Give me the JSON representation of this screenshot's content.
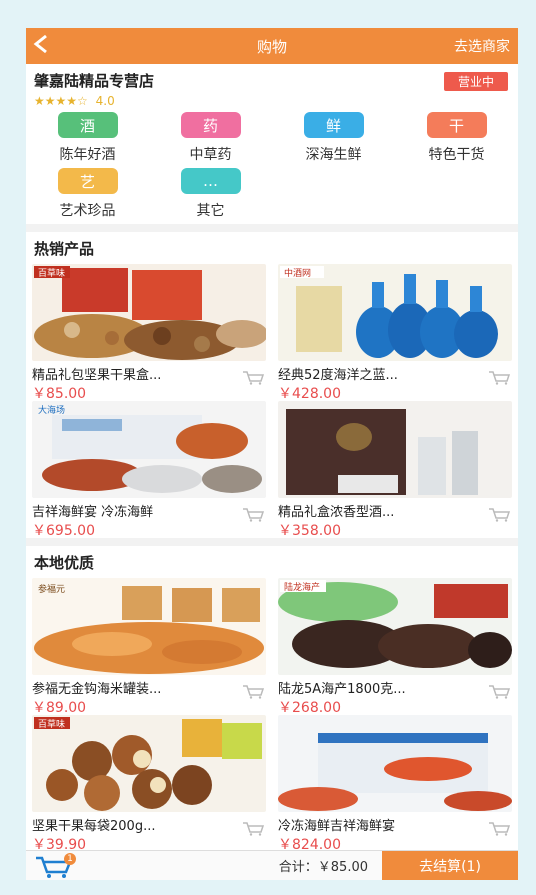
{
  "topbar": {
    "back_icon": "back-arrow-icon",
    "title": "购物",
    "right_label": "去选商家"
  },
  "store": {
    "name": "肇嘉陆精品专营店",
    "stars": "★★★★☆",
    "score": "4.0",
    "status": "营业中"
  },
  "categories": [
    {
      "icon_text": "酒",
      "label": "陈年好酒",
      "color": "#57c07a"
    },
    {
      "icon_text": "药",
      "label": "中草药",
      "color": "#f06fa0"
    },
    {
      "icon_text": "鲜",
      "label": "深海生鲜",
      "color": "#3aaee6"
    },
    {
      "icon_text": "干",
      "label": "特色干货",
      "color": "#f47c5a"
    },
    {
      "icon_text": "艺",
      "label": "艺术珍品",
      "color": "#f3b94a"
    },
    {
      "icon_text": "…",
      "label": "其它",
      "color": "#45c8c8"
    }
  ],
  "hot": {
    "title": "热销产品",
    "items": [
      {
        "name": "精品礼包坚果干果盒...",
        "price": "￥85.00",
        "image": "nut-gift-box-image",
        "brand": "百草味"
      },
      {
        "name": "经典52度海洋之蓝...",
        "price": "￥428.00",
        "image": "blue-liquor-bottles-image",
        "brand": "中酒网"
      },
      {
        "name": "吉祥海鲜宴 冷冻海鲜",
        "price": "￥695.00",
        "image": "seafood-feast-image",
        "brand": "大海场"
      },
      {
        "name": "精品礼盒浓香型酒...",
        "price": "￥358.00",
        "image": "liquor-gift-box-image",
        "brand": ""
      }
    ]
  },
  "local": {
    "title": "本地优质",
    "items": [
      {
        "name": "参福无金钩海米罐装...",
        "price": "￥89.00",
        "image": "dried-shrimp-jars-image",
        "brand": "参福元"
      },
      {
        "name": "陆龙5A海产1800克...",
        "price": "￥268.00",
        "image": "sea-cucumber-image",
        "brand": "陆龙海产"
      },
      {
        "name": "坚果干果每袋200g...",
        "price": "￥39.90",
        "image": "macadamia-nuts-image",
        "brand": "百草味"
      },
      {
        "name": "冷冻海鲜吉祥海鲜宴",
        "price": "￥824.00",
        "image": "shrimp-box-image",
        "brand": ""
      }
    ]
  },
  "bottom": {
    "cart_count": "1",
    "total": "合计：￥85.00",
    "checkout": "去结算(1)"
  },
  "colors": {
    "accent": "#f08b3c",
    "price": "#e84d4d",
    "status": "#ee5a4c"
  }
}
